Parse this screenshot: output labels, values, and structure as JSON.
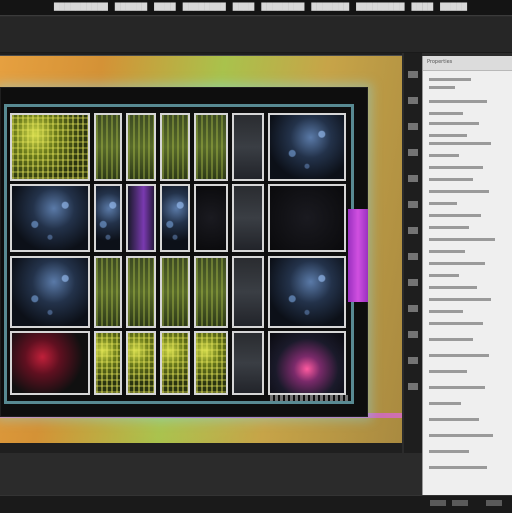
{
  "app": {
    "menu_items": [
      "██████████",
      "██████",
      "████",
      "████████",
      "████",
      "████████",
      "███████",
      "█████████",
      "████",
      "█████"
    ]
  },
  "document": {
    "caption": ""
  },
  "panel": {
    "tab_label": "Properties"
  },
  "colors": {
    "menubar": "#141414",
    "toolbar": "#262626",
    "canvas_gradient": "#e6a040",
    "frame_glow": "#78dcff",
    "handle": "#d050e0",
    "panel": "#efefef"
  }
}
